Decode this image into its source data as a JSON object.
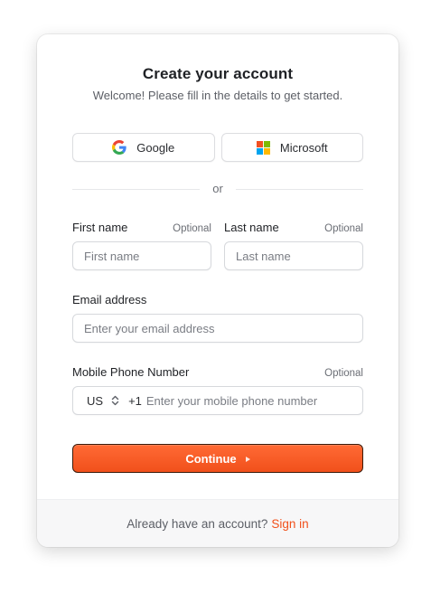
{
  "card": {
    "title": "Create your account",
    "subtitle": "Welcome! Please fill in the details to get started."
  },
  "social": {
    "google": {
      "label": "Google",
      "icon": "google-icon"
    },
    "microsoft": {
      "label": "Microsoft",
      "icon": "microsoft-icon"
    }
  },
  "divider": {
    "text": "or"
  },
  "form": {
    "first_name": {
      "label": "First name",
      "optional": "Optional",
      "placeholder": "First name"
    },
    "last_name": {
      "label": "Last name",
      "optional": "Optional",
      "placeholder": "Last name"
    },
    "email": {
      "label": "Email address",
      "placeholder": "Enter your email address"
    },
    "phone": {
      "label": "Mobile Phone Number",
      "optional": "Optional",
      "country": "US",
      "dial_code": "+1",
      "placeholder": "Enter your mobile phone number"
    }
  },
  "continue": {
    "label": "Continue"
  },
  "footer": {
    "text": "Already have an account?",
    "link": "Sign in"
  },
  "colors": {
    "accent": "#f1501b",
    "google_blue": "#4285F4",
    "google_red": "#EA4335",
    "google_yellow": "#FBBC05",
    "google_green": "#34A853",
    "ms_red": "#F25022",
    "ms_green": "#7FBA00",
    "ms_blue": "#00A4EF",
    "ms_yellow": "#FFB900"
  }
}
